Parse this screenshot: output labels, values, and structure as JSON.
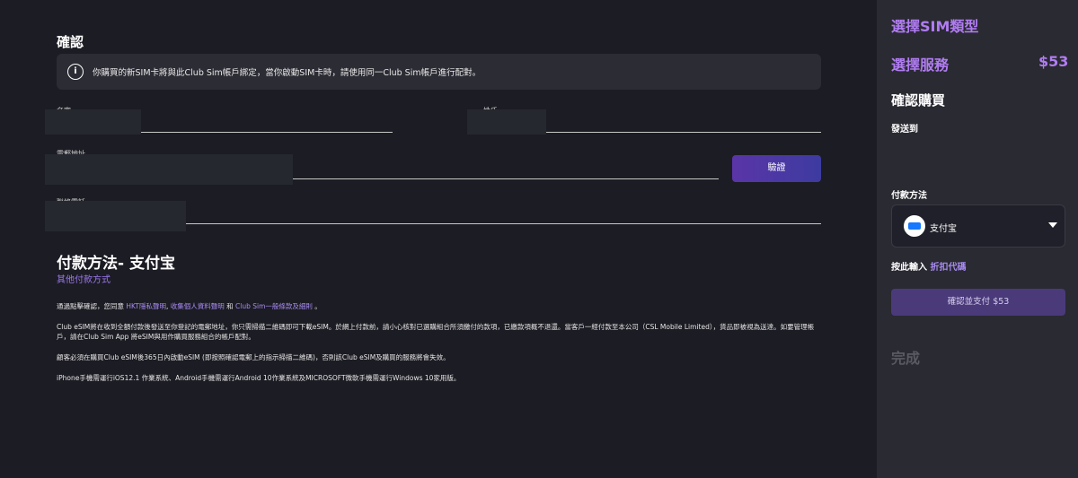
{
  "main": {
    "title": "確認",
    "notice": "你購買的新SIM卡將與此Club Sim帳戶綁定，當你啟動SIM卡時，請使用同一Club Sim帳戶進行配對。",
    "fields": {
      "first_name_label": "名字",
      "last_name_label": "姓氏",
      "email_label": "電郵地址",
      "phone_label": "聯絡電話"
    },
    "verify_button": "驗證",
    "payment_title": "付款方法- 支付宝",
    "other_payment": "其他付款方式",
    "terms": {
      "line1_prefix": "通過點擊確認，您同意 ",
      "link_privacy": "HKT隱私聲明",
      "sep1": ", ",
      "link_collect": "收集個人資料聲明",
      "sep2": " 和 ",
      "link_terms": "Club Sim一般條款及細則",
      "line1_suffix": " 。",
      "para2": "Club eSIM將在收到全額付款後發送至你登記的電郵地址，你只需掃描二維碼即可下載eSIM。於網上付款前，請小心核對已選購組合所須繳付的款項，已繳款項概不退還。當客戶一經付款至本公司（CSL Mobile Limited），貨品即被視為送達。如要管理帳戶，請在Club Sim App 將eSIM與用作購買服務組合的帳戶配對。",
      "para3": "顧客必須在購買Club eSIM後365日內啟動eSIM (即按照確認電郵上的指示掃描二維碼)，否則該Club eSIM及購買的服務將會失效。",
      "para4": "iPhone手機需運行iOS12.1 作業系統、Android手機需運行Android 10作業系統及MICROSOFT微軟手機需運行Windows 10家用版。"
    }
  },
  "sidebar": {
    "select_sim_type": "選擇SIM類型",
    "select_service": "選擇服務",
    "price": "$53",
    "confirm_purchase": "確認購買",
    "send_to": "發送到",
    "payment_method_label": "付款方法",
    "payment_option": "支付宝",
    "promo_prefix": "按此輸入 ",
    "promo_link": "折扣代碼",
    "confirm_pay_button": "確認並支付 $53",
    "done": "完成"
  },
  "icons": {
    "info": "info-icon",
    "alipay": "alipay-logo-icon",
    "dropdown": "chevron-down-icon"
  },
  "colors": {
    "accent_purple": "#b07cf2",
    "link_purple": "#a88bf2",
    "background": "#1c1c24",
    "sidebar_bg": "#2a2a32"
  }
}
